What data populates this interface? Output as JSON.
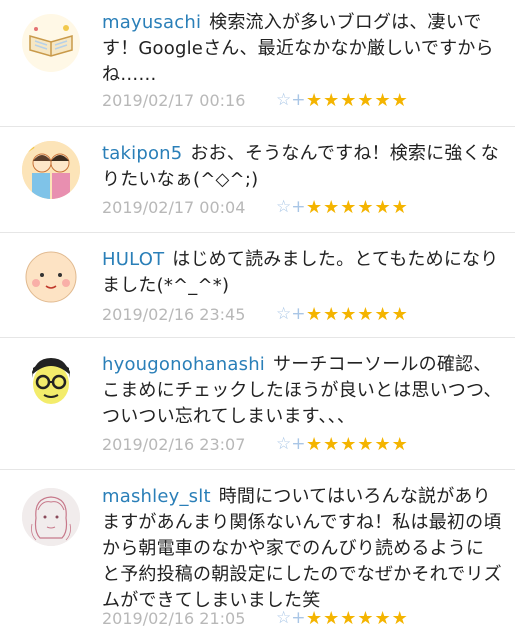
{
  "comments": [
    {
      "user": "mayusachi",
      "text": "検索流入が多いブログは、凄いです！Googleさん、最近なかなか厳しいですからね……",
      "date": "2019/02/17 00:16",
      "add_star": "☆+",
      "stars": "★★★★★★",
      "avatar": "open-book-icon"
    },
    {
      "user": "takipon5",
      "text": "おお、そうなんですね！検索に強くなりたいなぁ(^◇^;)",
      "date": "2019/02/17 00:04",
      "add_star": "☆+",
      "stars": "★★★★★★",
      "avatar": "family-illustration-icon"
    },
    {
      "user": "HULOT",
      "text": "はじめて読みました。とてもためになりました(*^_^*)",
      "date": "2019/02/16 23:45",
      "add_star": "☆+",
      "stars": "★★★★★★",
      "avatar": "smiling-face-icon"
    },
    {
      "user": "hyougonohanashi",
      "text": "サーチコーソールの確認、こまめにチェックしたほうが良いとは思いつつ、ついつい忘れてしまいます、、、",
      "date": "2019/02/16 23:07",
      "add_star": "☆+",
      "stars": "★★★★★★",
      "avatar": "glasses-man-icon"
    },
    {
      "user": "mashley_slt",
      "text": "時間についてはいろんな説がありますがあんまり関係ないんですね！私は最初の頃から朝電車のなかや家でのんびり読めるようにと予約投稿の朝設定にしたのでなぜかそれでリズムができてしまいました笑",
      "date": "2019/02/16 21:05",
      "add_star": "☆+",
      "stars": "★★★★★★",
      "avatar": "sketch-portrait-icon"
    }
  ]
}
